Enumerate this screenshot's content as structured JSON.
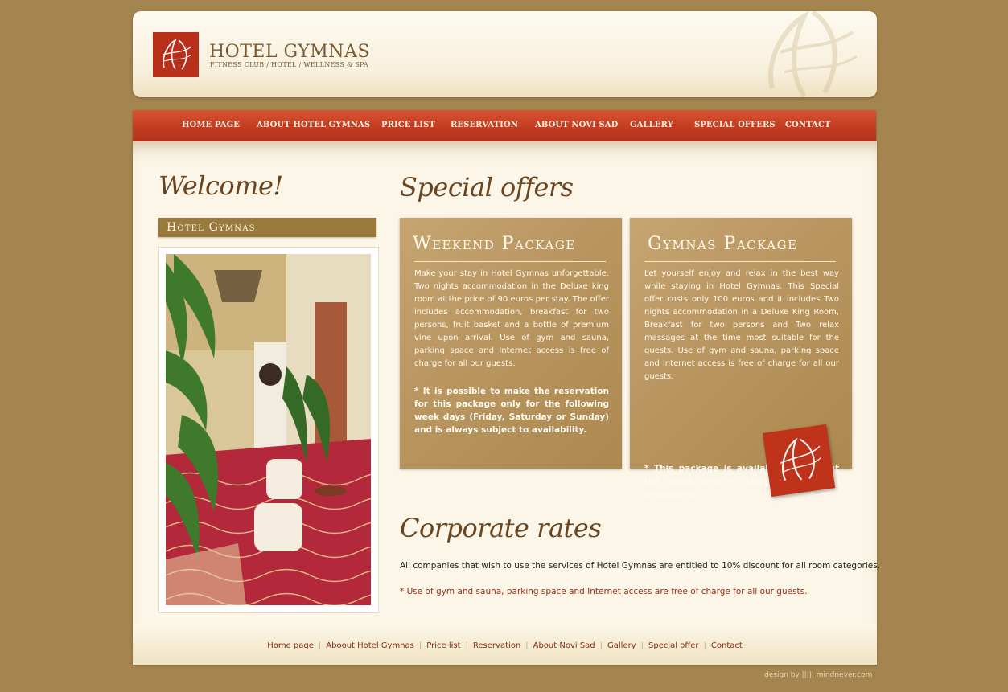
{
  "brand": {
    "name": "HOTEL GYMNAS",
    "tagline": "FITNESS CLUB / HOTEL / WELLNESS & SPA"
  },
  "nav": {
    "items": [
      {
        "label": "HOME PAGE"
      },
      {
        "label": "ABOUT HOTEL GYMNAS"
      },
      {
        "label": "PRICE LIST"
      },
      {
        "label": "RESERVATION"
      },
      {
        "label": "ABOUT NOVI SAD"
      },
      {
        "label": "GALLERY"
      },
      {
        "label": "SPECIAL OFFERS"
      },
      {
        "label": "CONTACT"
      }
    ]
  },
  "sidebar": {
    "title": "Welcome!",
    "section_heading": "Hotel Gymnas"
  },
  "special_offers": {
    "title": "Special offers",
    "cards": [
      {
        "title": "Weekend Package",
        "body": "Make your stay in Hotel Gymnas unforgettable. Two nights accommodation in the Deluxe king room at the price of 90 euros per stay. The offer includes accommodation, breakfast for two persons, fruit basket and a bottle of premium vine upon arrival. Use of gym and sauna, parking space and Internet access is free of charge for all our guests.",
        "note": "* It is possible to make the reservation for this package only for the following week days (Friday, Saturday or Sunday) and is always subject to availability."
      },
      {
        "title": "Gymnas Package",
        "body": "Let yourself enjoy and relax in the best way while staying in Hotel Gymnas. This Special offer costs only 100 euros and it includes Two nights accommodation in a Deluxe King Room, Breakfast for two persons and Two relax massages at the time most suitable for the guests. Use of gym and sauna, parking space and Internet access is free of charge for all our guests.",
        "note": "* This package is available throughout the week and is always subject to availability."
      }
    ]
  },
  "corporate": {
    "title": "Corporate rates",
    "text": "All companies that wish to use the services of Hotel Gymnas are entitled to 10% discount for all room categories.",
    "note": "* Use of gym and sauna, parking space and Internet access are free of charge for all our guests."
  },
  "footer": {
    "links": [
      "Home page",
      "Aboout Hotel Gymnas",
      "Price list",
      "Reservation",
      "About Novi Sad",
      "Gallery",
      "Special offer",
      "Contact"
    ],
    "separator": "|"
  },
  "credit": "design by ||||| mindnever.com",
  "colors": {
    "background": "#a4844f",
    "nav_red": "#c43e22",
    "accent_brown": "#9a7a3c",
    "card_tan": "#b99560",
    "content_cream": "#fbf6e7"
  }
}
